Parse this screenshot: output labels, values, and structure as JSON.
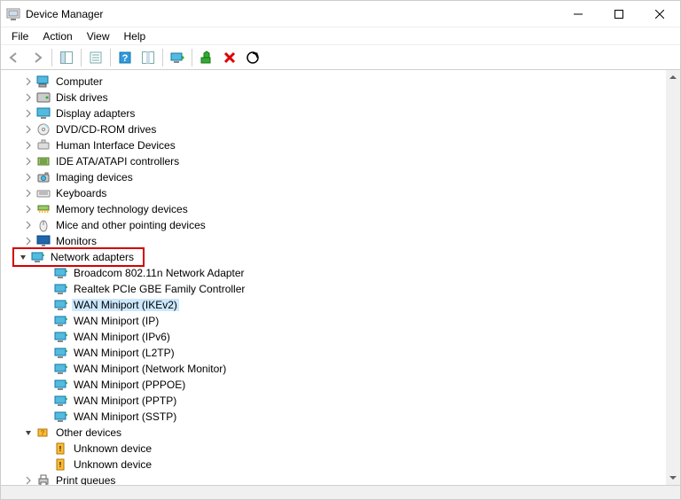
{
  "window": {
    "title": "Device Manager"
  },
  "menu": {
    "file": "File",
    "action": "Action",
    "view": "View",
    "help": "Help"
  },
  "tree": {
    "items": [
      {
        "label": "Computer",
        "indent": 18,
        "chev": "r",
        "icon": "computer",
        "sel": false
      },
      {
        "label": "Disk drives",
        "indent": 18,
        "chev": "r",
        "icon": "disk",
        "sel": false
      },
      {
        "label": "Display adapters",
        "indent": 18,
        "chev": "r",
        "icon": "display",
        "sel": false
      },
      {
        "label": "DVD/CD-ROM drives",
        "indent": 18,
        "chev": "r",
        "icon": "dvd",
        "sel": false
      },
      {
        "label": "Human Interface Devices",
        "indent": 18,
        "chev": "r",
        "icon": "hid",
        "sel": false
      },
      {
        "label": "IDE ATA/ATAPI controllers",
        "indent": 18,
        "chev": "r",
        "icon": "ide",
        "sel": false
      },
      {
        "label": "Imaging devices",
        "indent": 18,
        "chev": "r",
        "icon": "imaging",
        "sel": false
      },
      {
        "label": "Keyboards",
        "indent": 18,
        "chev": "r",
        "icon": "keyboard",
        "sel": false
      },
      {
        "label": "Memory technology devices",
        "indent": 18,
        "chev": "r",
        "icon": "memory",
        "sel": false
      },
      {
        "label": "Mice and other pointing devices",
        "indent": 18,
        "chev": "r",
        "icon": "mouse",
        "sel": false
      },
      {
        "label": "Monitors",
        "indent": 18,
        "chev": "r",
        "icon": "monitor",
        "sel": false
      },
      {
        "label": "Network adapters",
        "indent": 18,
        "chev": "d",
        "icon": "network",
        "sel": false,
        "boxed": true
      },
      {
        "label": "Broadcom 802.11n Network Adapter",
        "indent": 38,
        "chev": "n",
        "icon": "network",
        "sel": false
      },
      {
        "label": "Realtek PCIe GBE Family Controller",
        "indent": 38,
        "chev": "n",
        "icon": "network",
        "sel": false
      },
      {
        "label": "WAN Miniport (IKEv2)",
        "indent": 38,
        "chev": "n",
        "icon": "network",
        "sel": true
      },
      {
        "label": "WAN Miniport (IP)",
        "indent": 38,
        "chev": "n",
        "icon": "network",
        "sel": false
      },
      {
        "label": "WAN Miniport (IPv6)",
        "indent": 38,
        "chev": "n",
        "icon": "network",
        "sel": false
      },
      {
        "label": "WAN Miniport (L2TP)",
        "indent": 38,
        "chev": "n",
        "icon": "network",
        "sel": false
      },
      {
        "label": "WAN Miniport (Network Monitor)",
        "indent": 38,
        "chev": "n",
        "icon": "network",
        "sel": false
      },
      {
        "label": "WAN Miniport (PPPOE)",
        "indent": 38,
        "chev": "n",
        "icon": "network",
        "sel": false
      },
      {
        "label": "WAN Miniport (PPTP)",
        "indent": 38,
        "chev": "n",
        "icon": "network",
        "sel": false
      },
      {
        "label": "WAN Miniport (SSTP)",
        "indent": 38,
        "chev": "n",
        "icon": "network",
        "sel": false
      },
      {
        "label": "Other devices",
        "indent": 18,
        "chev": "d",
        "icon": "other",
        "sel": false
      },
      {
        "label": "Unknown device",
        "indent": 38,
        "chev": "n",
        "icon": "unknown",
        "sel": false
      },
      {
        "label": "Unknown device",
        "indent": 38,
        "chev": "n",
        "icon": "unknown",
        "sel": false
      },
      {
        "label": "Print queues",
        "indent": 18,
        "chev": "r",
        "icon": "printer",
        "sel": false
      }
    ]
  }
}
